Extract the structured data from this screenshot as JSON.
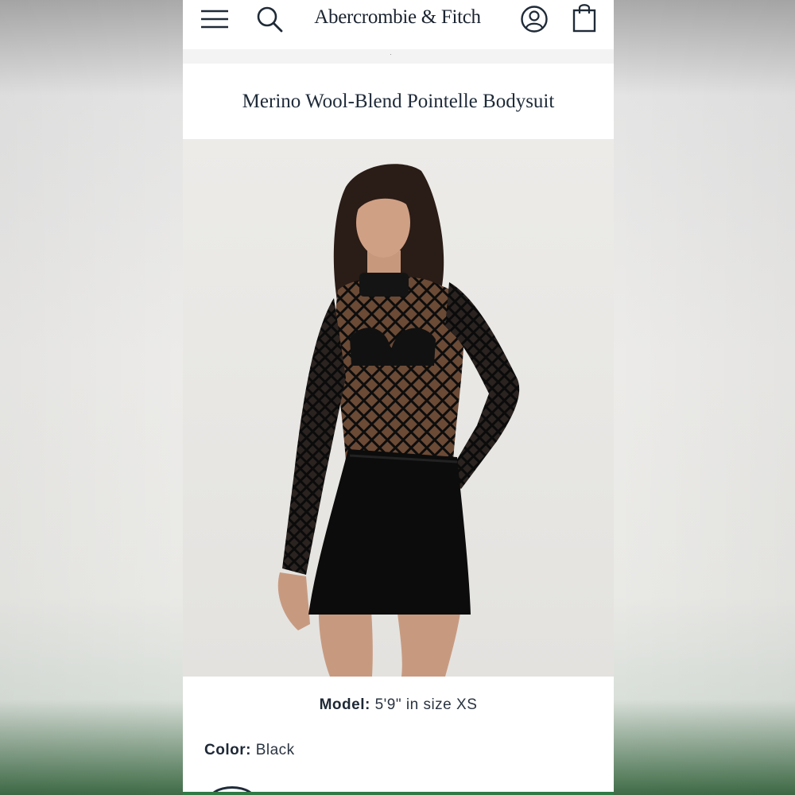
{
  "header": {
    "brand": "Abercrombie & Fitch",
    "icons": {
      "menu": "hamburger-menu-icon",
      "search": "search-icon",
      "account": "account-icon",
      "bag": "shopping-bag-icon"
    }
  },
  "product": {
    "title": "Merino Wool-Blend Pointelle Bodysuit",
    "model_label": "Model:",
    "model_value": "5'9\" in size XS",
    "color_label": "Color:",
    "color_value": "Black"
  },
  "colors": {
    "text_primary": "#1e2a38",
    "accent_green": "#2f7a45"
  }
}
